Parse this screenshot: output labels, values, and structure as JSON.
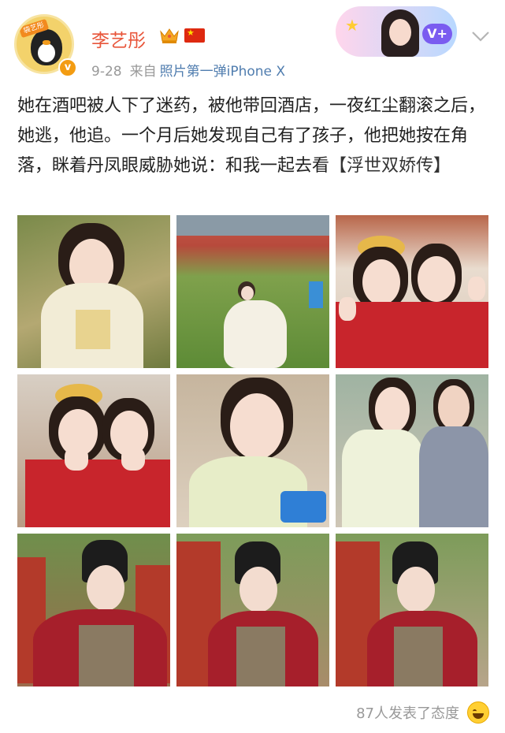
{
  "post": {
    "username": "李艺彤",
    "avatar_tag": "袋艺彤",
    "verified_mark": "v",
    "date": "9-28",
    "from_label": "来自",
    "source": "照片第一弹iPhone X",
    "vip_label": "V+",
    "text_before_topic": "她在酒吧被人下了迷药，被他带回酒店，一夜红尘翻滚之后，她逃，他追。一个月后她发现自己有了孩子，他把她按在角落，眯着丹凤眼威胁她说：和我一起去看",
    "topic": "【浮世双娇传】"
  },
  "photos": [
    {
      "name": "photo-1",
      "desc_icon": "portrait-photo"
    },
    {
      "name": "photo-2",
      "desc_icon": "lawn-photo"
    },
    {
      "name": "photo-3",
      "desc_icon": "duo-selfie-photo"
    },
    {
      "name": "photo-4",
      "desc_icon": "duo-selfie-photo"
    },
    {
      "name": "photo-5",
      "desc_icon": "portrait-photo"
    },
    {
      "name": "photo-6",
      "desc_icon": "duo-photo"
    },
    {
      "name": "photo-7",
      "desc_icon": "costume-photo"
    },
    {
      "name": "photo-8",
      "desc_icon": "costume-photo"
    },
    {
      "name": "photo-9",
      "desc_icon": "costume-photo"
    }
  ],
  "reactions": {
    "text": "87人发表了态度",
    "emoji_icon": "grinning-face-icon"
  },
  "colors": {
    "username": "#e8553a",
    "link": "#507daf",
    "meta": "#999999"
  }
}
